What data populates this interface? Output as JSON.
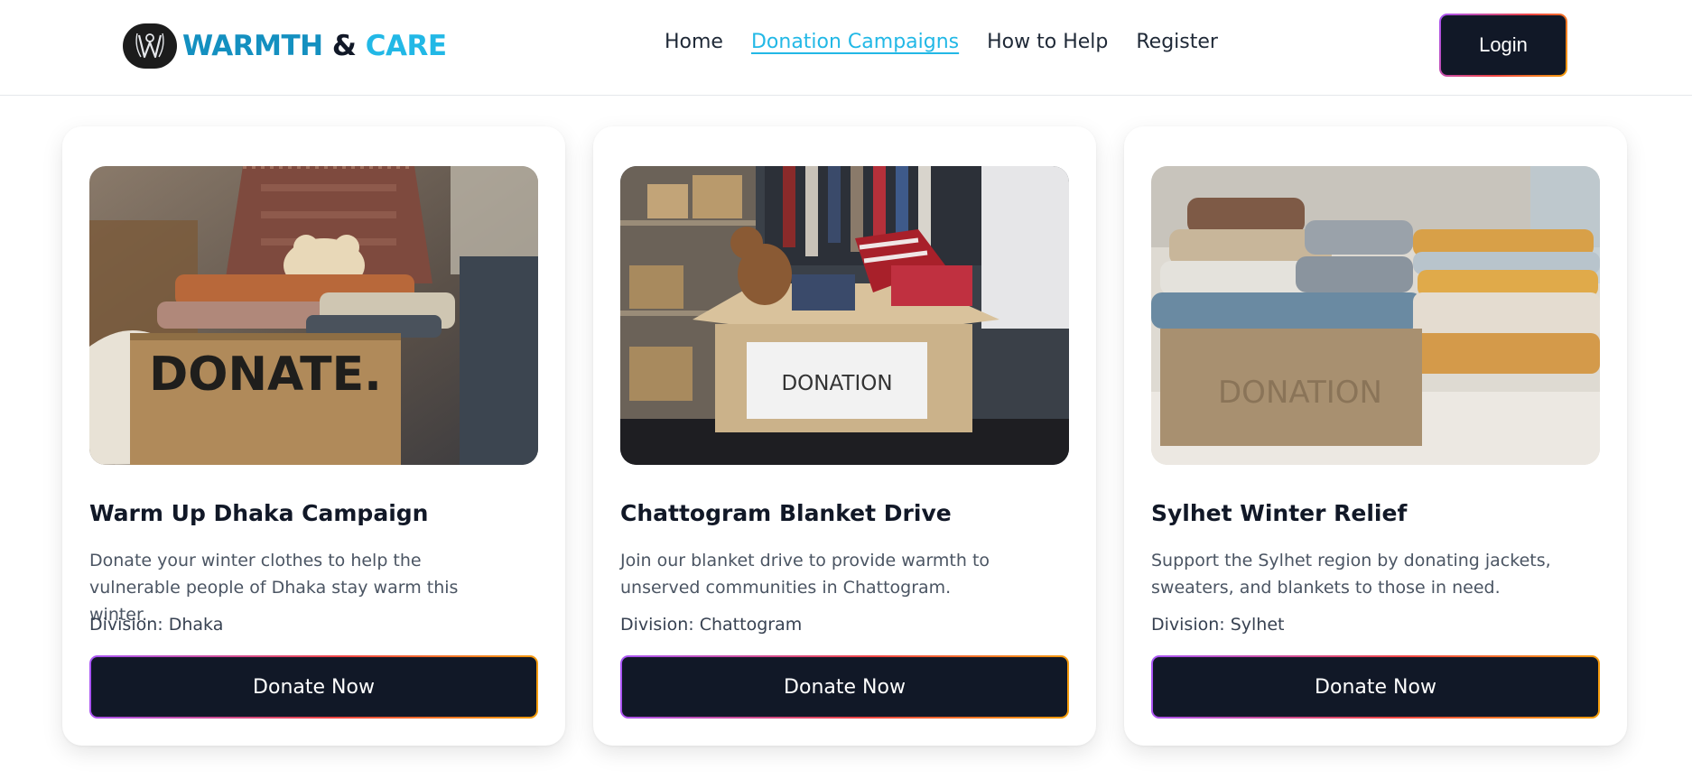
{
  "brand": {
    "name_part1": "WARMTH",
    "name_part2": "&",
    "name_part3": "CARE",
    "colors": {
      "primary": "#1490c0",
      "accent": "#22b8e6",
      "dark": "#111827"
    }
  },
  "nav": {
    "items": [
      {
        "label": "Home",
        "active": false
      },
      {
        "label": "Donation Campaigns",
        "active": true
      },
      {
        "label": "How to Help",
        "active": false
      },
      {
        "label": "Register",
        "active": false
      }
    ],
    "login_label": "Login"
  },
  "campaigns": [
    {
      "title": "Warm Up Dhaka Campaign",
      "description": "Donate your winter clothes to help the vulnerable people of Dhaka stay warm this winter.",
      "division": "Division: Dhaka",
      "image_icon": "donate-box-photo",
      "box_text": "DONATE.",
      "button_label": "Donate Now"
    },
    {
      "title": "Chattogram Blanket Drive",
      "description": "Join our blanket drive to provide warmth to unserved communities in Chattogram.",
      "division": "Division: Chattogram",
      "image_icon": "donation-box-photo",
      "box_text": "DONATION",
      "button_label": "Donate Now"
    },
    {
      "title": "Sylhet Winter Relief",
      "description": "Support the Sylhet region by donating jackets, sweaters, and blankets to those in need.",
      "division": "Division: Sylhet",
      "image_icon": "donation-box-photo",
      "box_text": "DONATION",
      "button_label": "Donate Now"
    }
  ]
}
